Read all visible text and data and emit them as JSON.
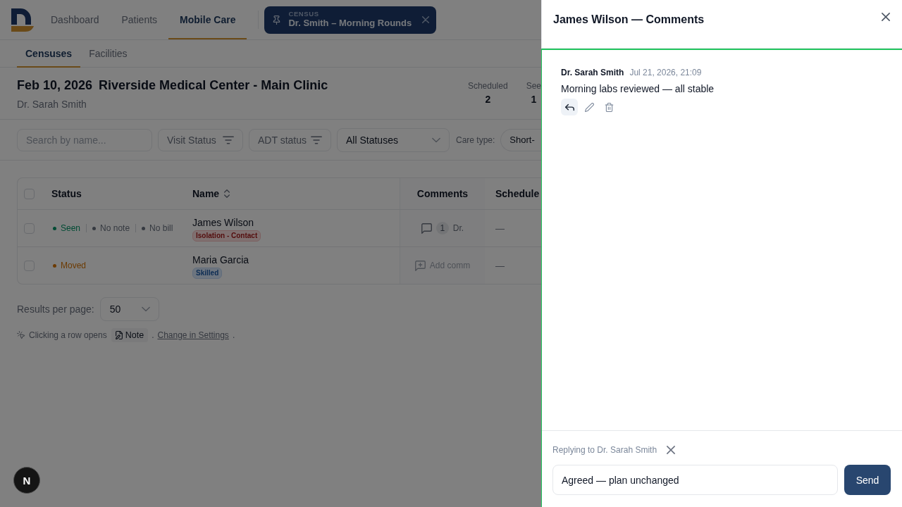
{
  "header": {
    "nav": [
      {
        "label": "Dashboard",
        "selected": false
      },
      {
        "label": "Patients",
        "selected": false
      },
      {
        "label": "Mobile Care",
        "selected": true
      }
    ],
    "census_chip": {
      "caption": "CENSUS",
      "title": "Dr. Smith – Morning Rounds"
    }
  },
  "subtabs": [
    {
      "label": "Censuses",
      "selected": true
    },
    {
      "label": "Facilities",
      "selected": false
    }
  ],
  "census": {
    "date": "Feb 10, 2026",
    "facility": "Riverside Medical Center - Main Clinic",
    "provider": "Dr. Sarah Smith",
    "stats": [
      {
        "label": "Scheduled",
        "value": "2"
      },
      {
        "label": "See",
        "value": "1"
      }
    ]
  },
  "filters": {
    "search": {
      "placeholder": "Search by name..."
    },
    "buttons": [
      "Visit Status",
      "ADT status"
    ],
    "status_select": "All Statuses",
    "care_type": {
      "label": "Care type:",
      "value": "Short-"
    }
  },
  "table": {
    "header_checked": false,
    "columns": [
      {
        "label": "Status",
        "sortable": false
      },
      {
        "label": "Name",
        "sortable": true
      },
      {
        "label": "Comments",
        "sortable": false
      },
      {
        "label": "Schedule",
        "sortable": false
      }
    ],
    "rows": [
      {
        "checked": false,
        "statuses": [
          {
            "label": "Seen",
            "color": "#024b34"
          },
          {
            "label": "No note",
            "color": "#353940"
          },
          {
            "label": "No bill",
            "color": "#353940"
          }
        ],
        "name": "James Wilson",
        "tag": {
          "label": "Isolation - Contact",
          "color": "#7f7171"
        },
        "comments": {
          "kind": "thread",
          "count": "1",
          "preview": "Dr."
        },
        "schedule": "—"
      },
      {
        "checked": false,
        "statuses": [
          {
            "label": "Moved",
            "color": "#6c3b03"
          }
        ],
        "name": "Maria Garcia",
        "tag": {
          "label": "Skilled",
          "color": "#6d757f"
        },
        "comments": {
          "kind": "add",
          "label": "Add comm"
        },
        "schedule": "—"
      }
    ]
  },
  "pagination": {
    "label": "Results per page:",
    "value": "50"
  },
  "row_click_hint": {
    "text": "Clicking a row opens",
    "chip": "Note",
    "separator": ".",
    "link": "Change in Settings",
    "end": "."
  },
  "drawer": {
    "title": "James Wilson — Comments",
    "comments": [
      {
        "author": "Dr. Sarah Smith",
        "time": "Jul 21, 2026, 21:09",
        "text": "Morning labs reviewed — all stable",
        "actions": [
          {
            "kind": "reply",
            "active": true
          },
          {
            "kind": "edit",
            "active": false
          },
          {
            "kind": "delete",
            "active": false
          }
        ]
      }
    ],
    "composer": {
      "replying_to": "Replying to Dr. Sarah Smith",
      "value": "Agreed — plan unchanged",
      "send": "Send"
    }
  },
  "dev_indicator": {
    "label": "N"
  }
}
